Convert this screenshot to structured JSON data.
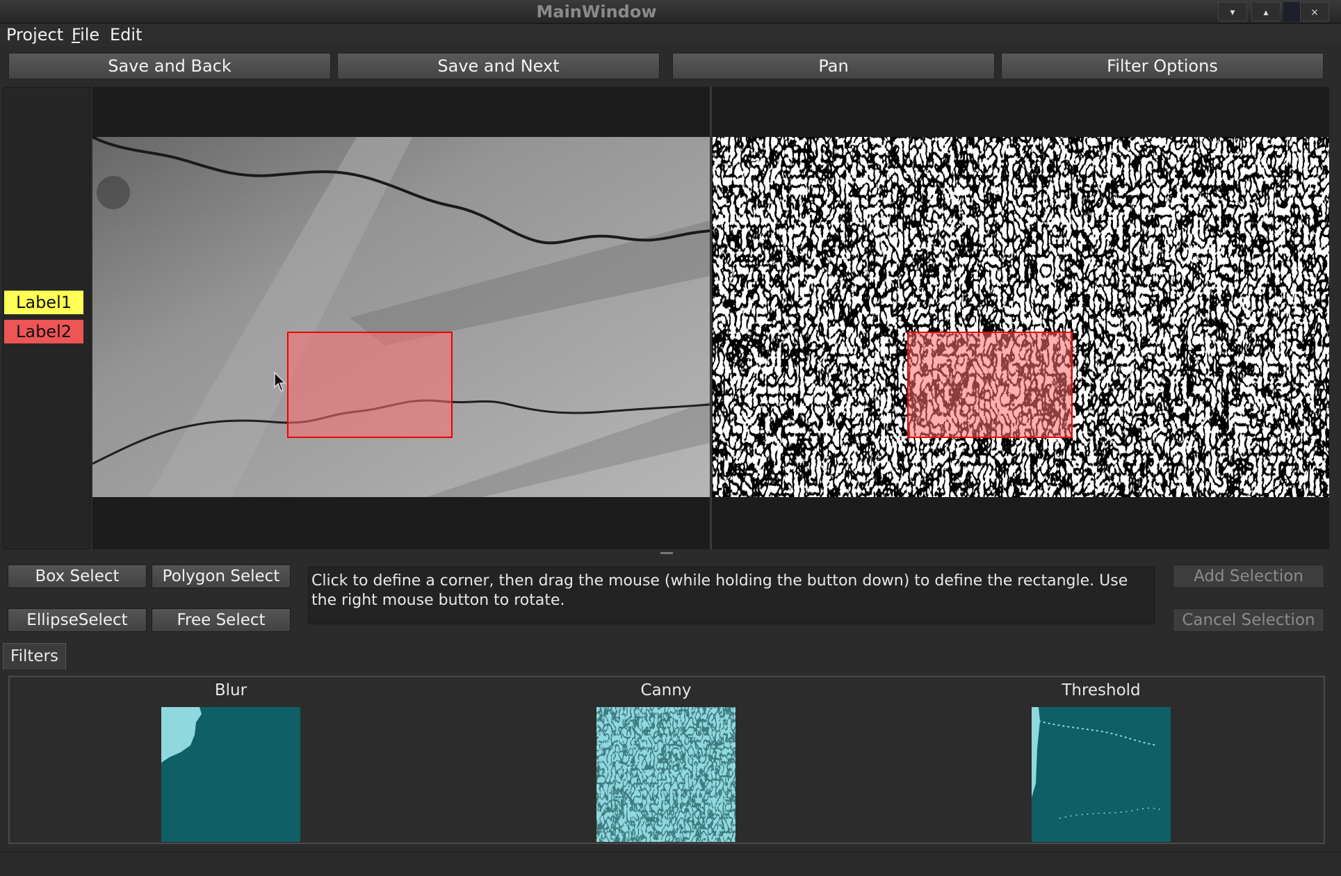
{
  "window": {
    "title": "MainWindow",
    "controls": [
      "▾",
      "▴",
      "×"
    ]
  },
  "menu": {
    "items": [
      {
        "label": "Project"
      },
      {
        "mnemonic": "F",
        "rest": "ile"
      },
      {
        "label": "Edit"
      }
    ]
  },
  "toolbar": {
    "save_back": "Save and Back",
    "save_next": "Save and Next",
    "pan": "Pan",
    "filter_options": "Filter Options"
  },
  "labels": [
    {
      "name": "Label1",
      "color": "#ffff55"
    },
    {
      "name": "Label2",
      "color": "#ee5555"
    }
  ],
  "selection": {
    "color": "#ff0000"
  },
  "tools": {
    "box_select": "Box Select",
    "polygon_select": "Polygon Select",
    "ellipse_select": "EllipseSelect",
    "free_select": "Free Select",
    "help_text": "Click to define a corner, then drag the mouse (while holding the button down) to define the rectangle. Use the right mouse button to rotate.",
    "add_selection": "Add Selection",
    "cancel_selection": "Cancel Selection"
  },
  "filters": {
    "tab_label": "Filters",
    "items": [
      {
        "name": "Blur"
      },
      {
        "name": "Canny"
      },
      {
        "name": "Threshold"
      }
    ],
    "thumb_color_dark": "#0e5f66",
    "thumb_color_light": "#8fd8de"
  }
}
